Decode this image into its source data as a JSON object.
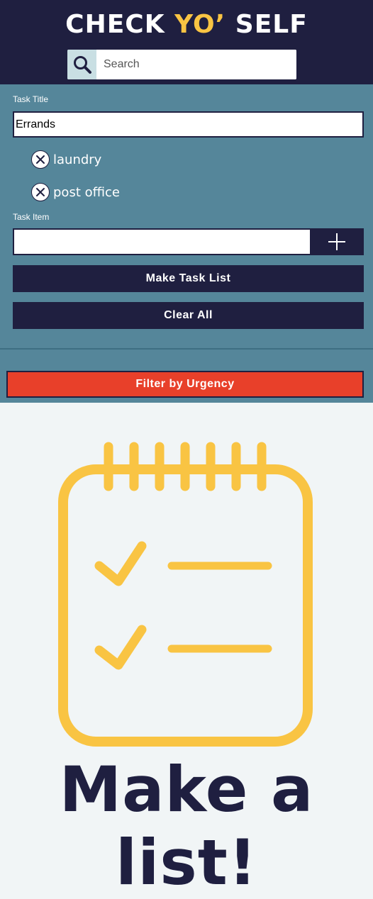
{
  "header": {
    "title_part1": "CHECK ",
    "title_accent": "YO’",
    "title_part2": " SELF",
    "accent_color": "#f9c443",
    "background_color": "#1f1f40"
  },
  "search": {
    "placeholder": "Search",
    "value": "",
    "icon": "search-icon"
  },
  "form": {
    "task_title_label": "Task Title",
    "task_title_value": "Errands",
    "task_items": [
      {
        "text": "laundry",
        "icon": "close-circle-icon"
      },
      {
        "text": "post office",
        "icon": "close-circle-icon"
      }
    ],
    "task_item_label": "Task Item",
    "task_item_value": "",
    "add_icon": "plus-icon",
    "make_task_list_label": "Make Task List",
    "clear_all_label": "Clear All",
    "panel_color": "#55869a"
  },
  "filter": {
    "label": "Filter by Urgency",
    "color": "#e8402a"
  },
  "empty_state": {
    "icon": "notepad-checklist-icon",
    "message": "Make a list!",
    "icon_color": "#f9c443"
  }
}
